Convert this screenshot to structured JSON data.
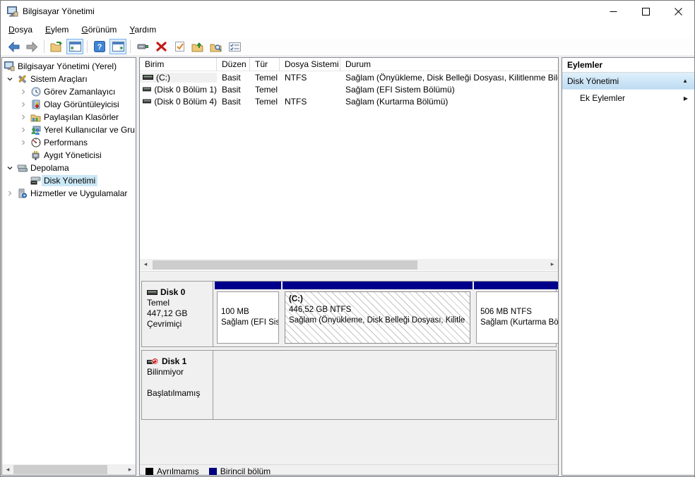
{
  "window": {
    "title": "Bilgisayar Yönetimi",
    "controls": [
      "minimize-icon",
      "maximize-icon",
      "close-icon"
    ]
  },
  "menu": {
    "items": [
      {
        "label": "Dosya"
      },
      {
        "label": "Eylem"
      },
      {
        "label": "Görünüm"
      },
      {
        "label": "Yardım"
      }
    ]
  },
  "toolbar": {
    "icons": [
      "back-icon",
      "forward-icon",
      "export-list-icon",
      "show-console-tree-icon",
      "help-icon",
      "show-action-pane-icon",
      "device-icon",
      "delete-icon",
      "check-page-icon",
      "folder-up-icon",
      "folder-find-icon",
      "list-view-icon"
    ]
  },
  "tree": {
    "items": [
      {
        "label": "Bilgisayar Yönetimi (Yerel)"
      },
      {
        "label": "Sistem Araçları"
      },
      {
        "label": "Görev Zamanlayıcı"
      },
      {
        "label": "Olay Görüntüleyicisi"
      },
      {
        "label": "Paylaşılan Klasörler"
      },
      {
        "label": "Yerel Kullanıcılar ve Gru"
      },
      {
        "label": "Performans"
      },
      {
        "label": "Aygıt Yöneticisi"
      },
      {
        "label": "Depolama"
      },
      {
        "label": "Disk Yönetimi"
      },
      {
        "label": "Hizmetler ve Uygulamalar"
      }
    ],
    "selected": "Disk Yönetimi"
  },
  "volume_list": {
    "columns": [
      "Birim",
      "Düzen",
      "Tür",
      "Dosya Sistemi",
      "Durum"
    ],
    "rows": [
      {
        "volume": "(C:)",
        "layout": "Basit",
        "type": "Temel",
        "fs": "NTFS",
        "status": "Sağlam (Önyükleme, Disk Belleği Dosyası, Kilitlenme Bilgis"
      },
      {
        "volume": "(Disk 0 Bölüm 1)",
        "layout": "Basit",
        "type": "Temel",
        "fs": "",
        "status": "Sağlam (EFI Sistem Bölümü)"
      },
      {
        "volume": "(Disk 0 Bölüm 4)",
        "layout": "Basit",
        "type": "Temel",
        "fs": "NTFS",
        "status": "Sağlam (Kurtarma Bölümü)"
      }
    ]
  },
  "disks": [
    {
      "name": "Disk 0",
      "line1": "Temel",
      "line2": "447,12 GB",
      "line3": "Çevrimiçi",
      "partitions": [
        {
          "name": "",
          "size": "100 MB",
          "status": "Sağlam (EFI Sis"
        },
        {
          "name": "(C:)",
          "size": "446,52 GB NTFS",
          "status": "Sağlam (Önyükleme, Disk Belleği Dosyası, Kilitle"
        },
        {
          "name": "",
          "size": "506 MB NTFS",
          "status": "Sağlam (Kurtarma Bö"
        }
      ]
    },
    {
      "name": "Disk 1",
      "line1": "Bilinmiyor",
      "line2": "",
      "line3": "Başlatılmamış"
    }
  ],
  "legend": {
    "items": [
      {
        "label": "Ayrılmamış",
        "color": "#000000"
      },
      {
        "label": "Birincil bölüm",
        "color": "#000080"
      }
    ]
  },
  "actions": {
    "header": "Eylemler",
    "section": "Disk Yönetimi",
    "items": [
      {
        "label": "Ek Eylemler"
      }
    ]
  },
  "colors": {
    "selection": "#cbe8f6",
    "partition_bar": "#00008b",
    "unallocated": "#000000",
    "primary_partition": "#000080",
    "actions_section_bg": "#cfe4f7"
  }
}
